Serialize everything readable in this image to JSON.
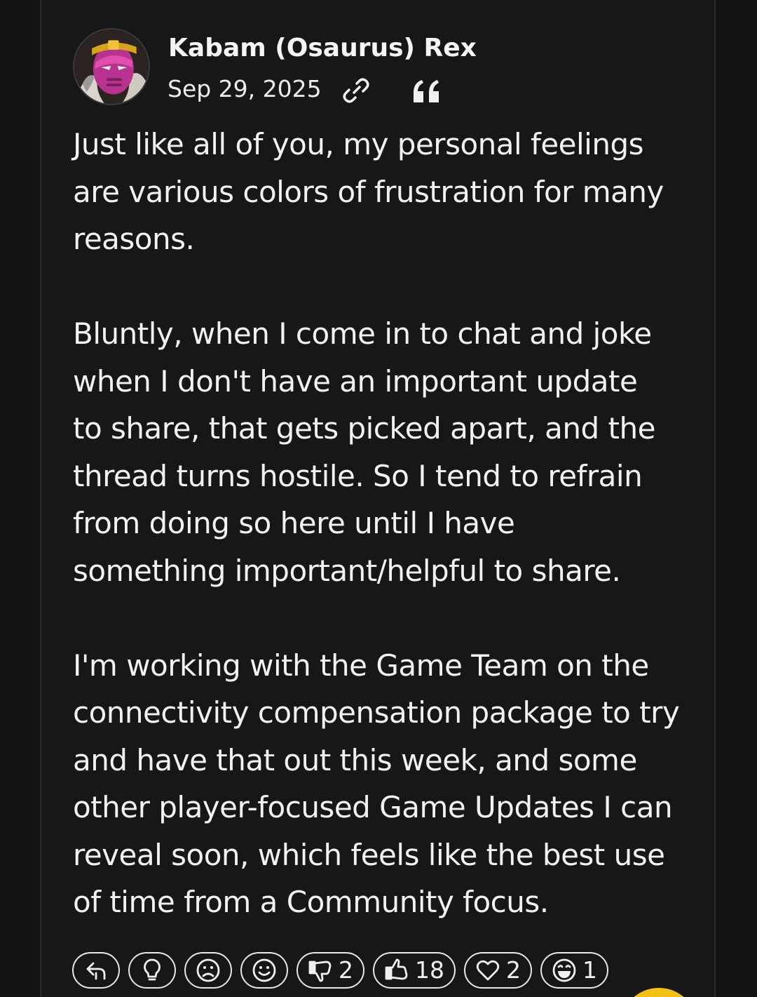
{
  "post": {
    "author": "Kabam (Osaurus) Rex",
    "date": "Sep 29, 2025",
    "paragraphs": [
      [
        "Just like all of you, my personal feelings",
        "are various colors of frustration for many",
        "reasons."
      ],
      [
        "Bluntly, when I come in to chat and joke",
        "when I don't have an important update",
        "to share, that gets picked apart, and the",
        "thread turns hostile. So I tend to refrain",
        "from doing so here until I have",
        "something important/helpful to share."
      ],
      [
        "I'm working with the Game Team on the",
        "connectivity compensation package to try",
        "and have that out this week, and some",
        "other player-focused Game Updates I can",
        "reveal soon, which feels like the best use",
        "of time from a Community focus."
      ]
    ]
  },
  "icons": {
    "avatar": "villain-avatar",
    "permalink": "link-icon",
    "quote": "quote-icon"
  },
  "reactions": [
    {
      "icon": "reply-arrow-icon",
      "count": ""
    },
    {
      "icon": "lightbulb-icon",
      "count": ""
    },
    {
      "icon": "sad-face-icon",
      "count": ""
    },
    {
      "icon": "smile-face-icon",
      "count": ""
    },
    {
      "icon": "thumbs-down-icon",
      "count": "2"
    },
    {
      "icon": "thumbs-up-icon",
      "count": "18"
    },
    {
      "icon": "heart-icon",
      "count": "2"
    },
    {
      "icon": "laugh-face-icon",
      "count": "1"
    }
  ],
  "colors": {
    "background": "#131313",
    "card": "#171717",
    "text": "#f2f2f2",
    "accent_yellow": "#f3c014"
  }
}
